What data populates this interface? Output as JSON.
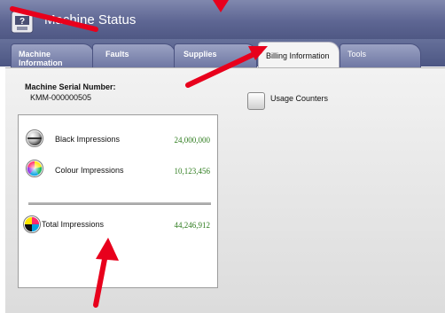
{
  "header": {
    "title": "Machine Status"
  },
  "tabs": [
    {
      "label": "Machine Information"
    },
    {
      "label": "Faults"
    },
    {
      "label": "Supplies"
    },
    {
      "label": "Billing Information"
    },
    {
      "label": "Tools"
    }
  ],
  "billing": {
    "serial_label": "Machine Serial Number:",
    "serial_value": "KMM-000000505",
    "usage_counters_label": "Usage Counters",
    "rows": [
      {
        "label": "Black Impressions",
        "value": "24,000,000"
      },
      {
        "label": "Colour Impressions",
        "value": "10,123,456"
      },
      {
        "label": "Total Impressions",
        "value": "44,246,912"
      }
    ]
  },
  "colors": {
    "header": "#5e6693",
    "value_text": "#2e7c1e",
    "annotation_arrow": "#e8001c"
  }
}
